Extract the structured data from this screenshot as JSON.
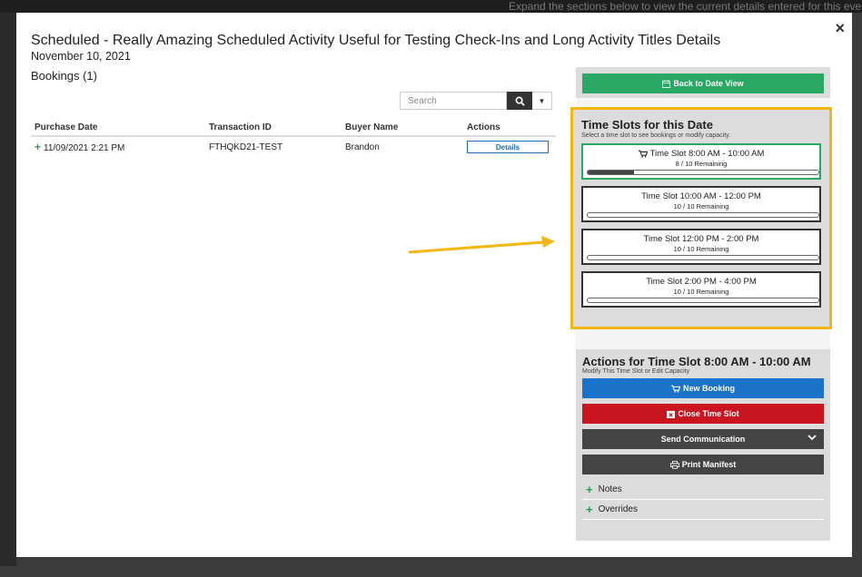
{
  "background": {
    "strip_text": "Expand the sections below to view the current details entered for this event"
  },
  "modal": {
    "close_glyph": "×",
    "title": "Scheduled - Really Amazing Scheduled Activity Useful for Testing Check-Ins and Long Activity Titles Details",
    "date": "November 10, 2021",
    "bookings_heading": "Bookings (1)"
  },
  "search": {
    "placeholder": "Search",
    "icon": "search-icon",
    "dropdown_icon": "caret-down-icon"
  },
  "table": {
    "headers": [
      "Purchase Date",
      "Transaction ID",
      "Buyer Name",
      "Actions"
    ],
    "rows": [
      {
        "purchase_date": "11/09/2021 2:21 PM",
        "transaction_id": "FTHQKD21-TEST",
        "buyer_name": "Brandon",
        "action_label": "Details"
      }
    ]
  },
  "right_panel": {
    "back_button": "Back to Date View",
    "slots_title": "Time Slots for this Date",
    "slots_subtitle": "Select a time slot to see bookings or modify capacity.",
    "slots": [
      {
        "label": "Time Slot 8:00 AM - 10:00 AM",
        "remaining": "8 / 10 Remaining",
        "fill": 0.2,
        "active": true
      },
      {
        "label": "Time Slot 10:00 AM - 12:00 PM",
        "remaining": "10 / 10 Remaining",
        "fill": 0,
        "active": false
      },
      {
        "label": "Time Slot 12:00 PM - 2:00 PM",
        "remaining": "10 / 10 Remaining",
        "fill": 0,
        "active": false
      },
      {
        "label": "Time Slot 2:00 PM - 4:00 PM",
        "remaining": "10 / 10 Remaining",
        "fill": 0,
        "active": false
      }
    ],
    "actions_title": "Actions for Time Slot 8:00 AM - 10:00 AM",
    "actions_subtitle": "Modify This Time Slot or Edit Capacity",
    "buttons": {
      "new_booking": "New Booking",
      "close_slot": "Close Time Slot",
      "send_communication": "Send Communication",
      "print_manifest": "Print Manifest"
    },
    "accordions": [
      "Notes",
      "Overrides"
    ]
  },
  "colors": {
    "accent_green": "#28a862",
    "blue": "#1a73c8",
    "red": "#c8151f",
    "highlight": "#f2b712"
  }
}
